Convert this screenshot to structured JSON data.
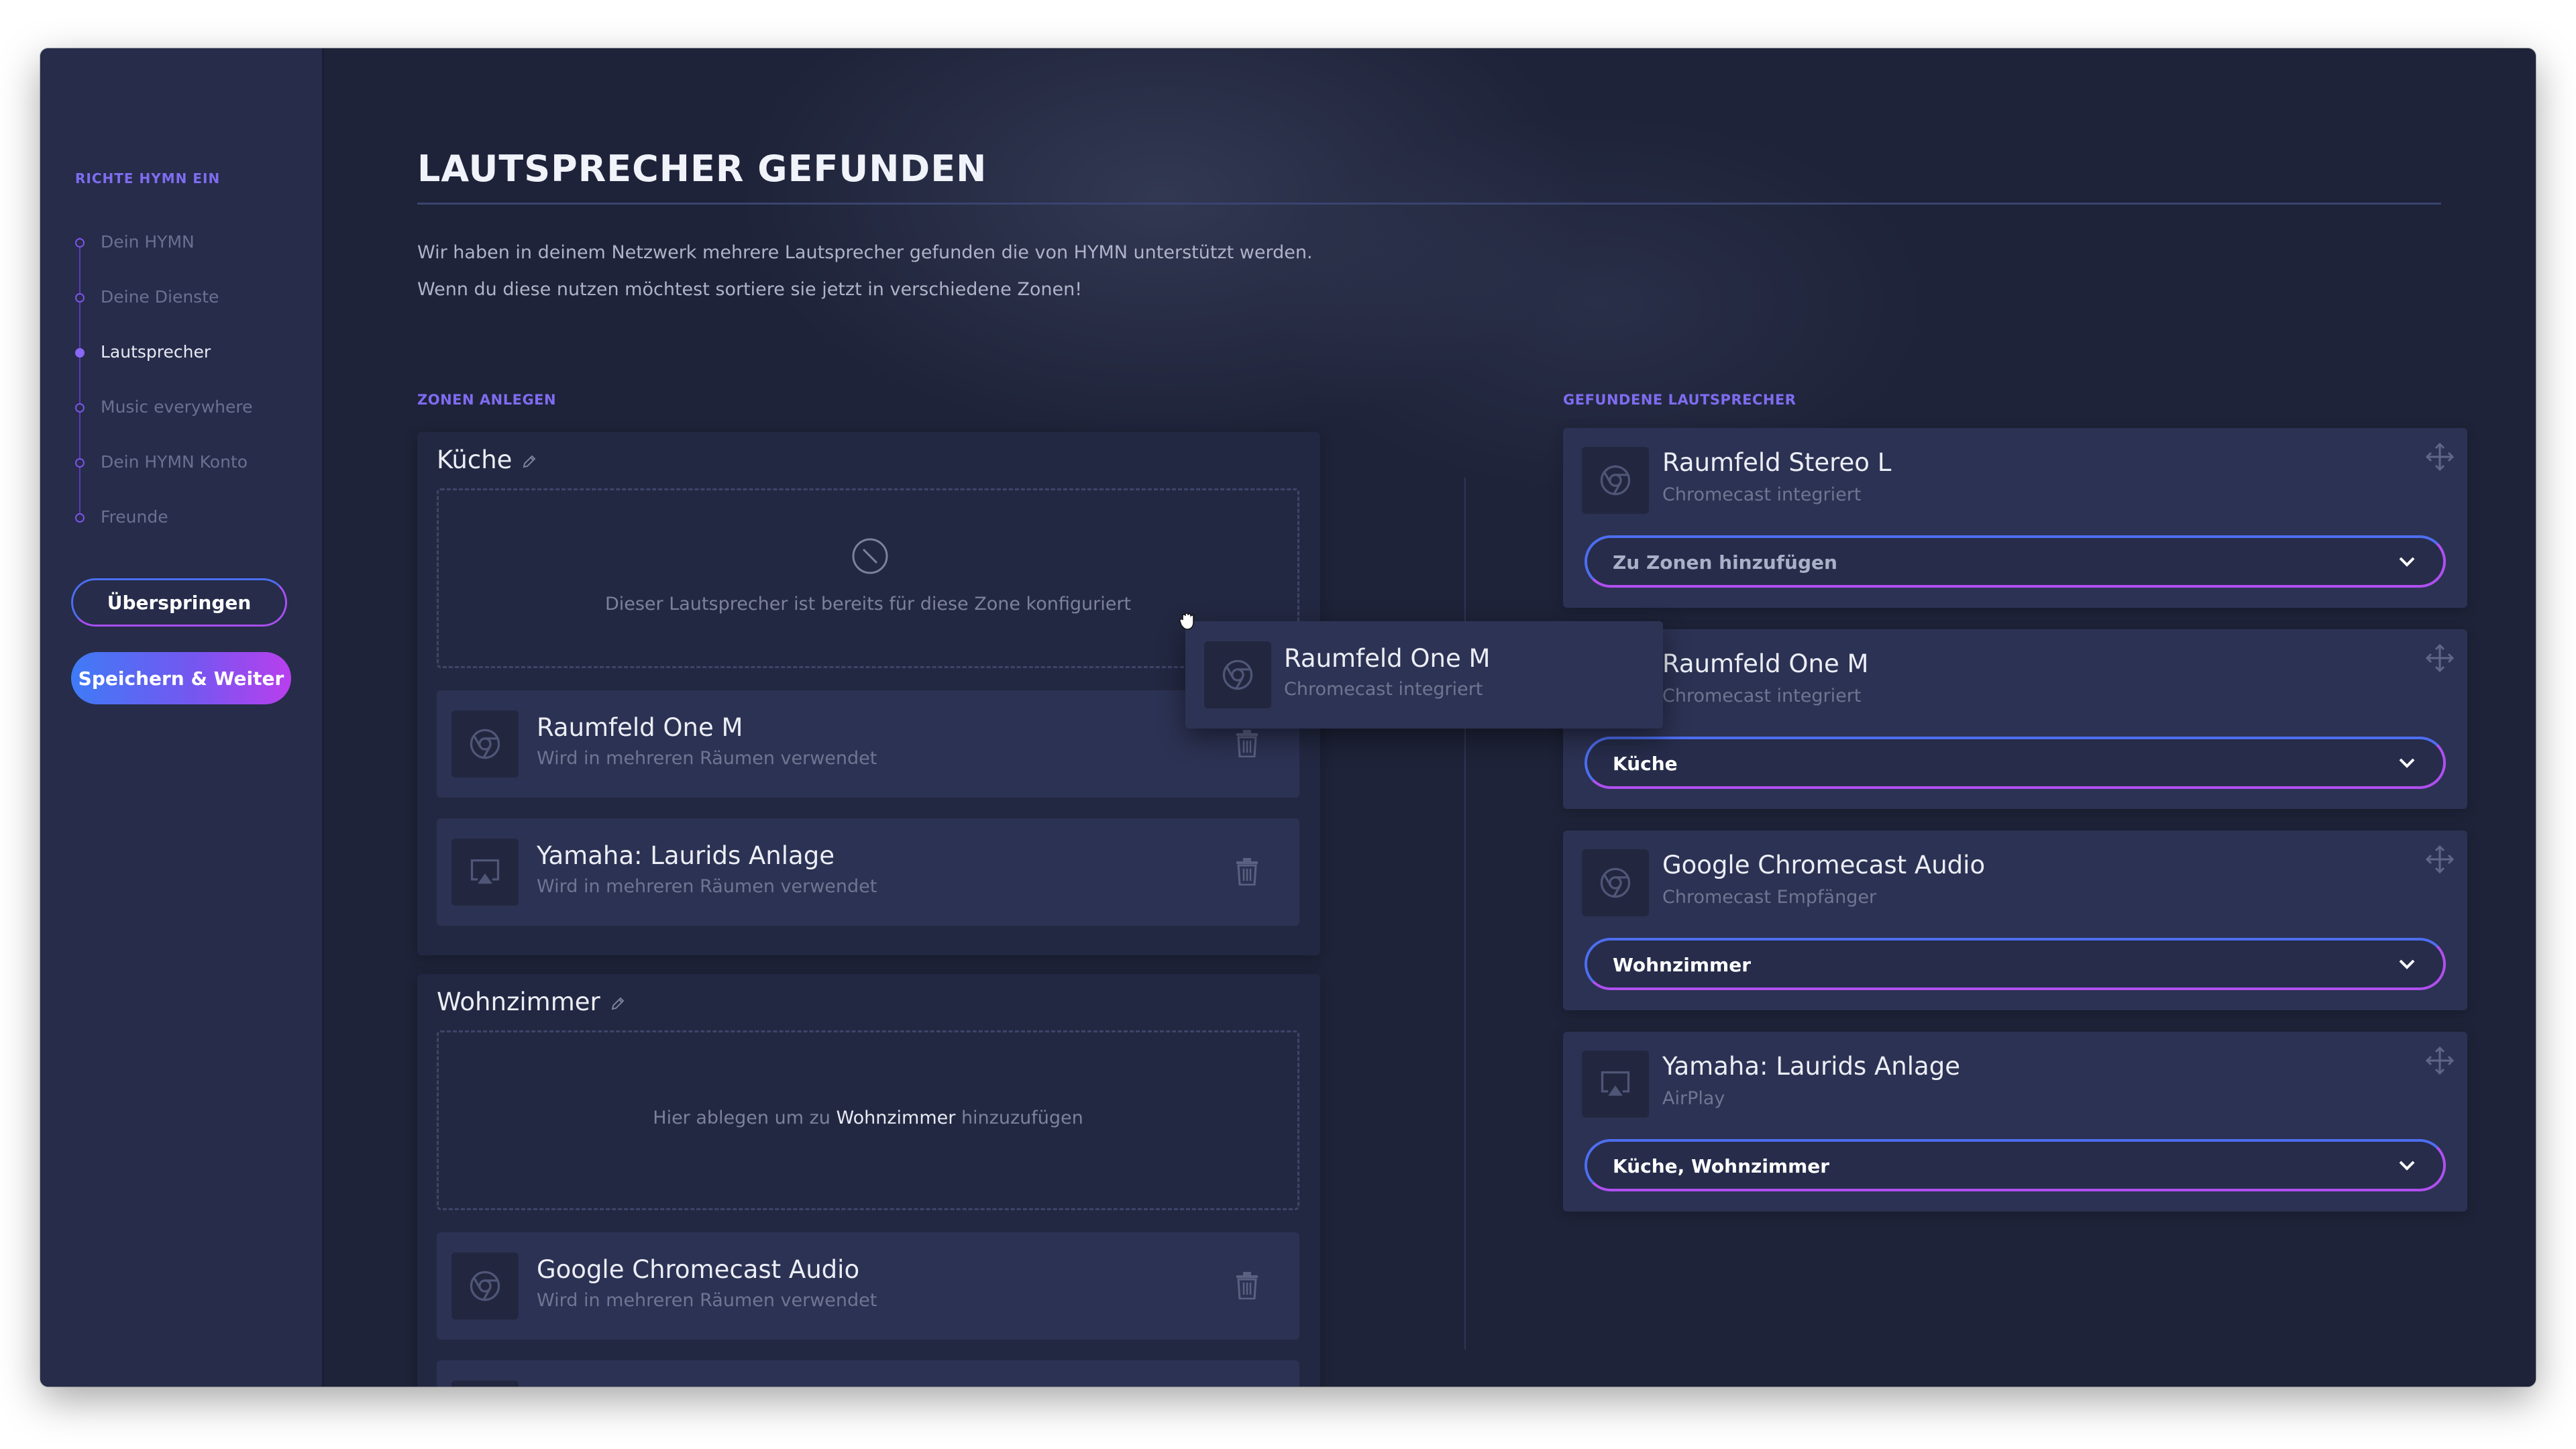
{
  "sidebar": {
    "title": "RICHTE HYMN EIN",
    "steps": [
      {
        "label": "Dein HYMN",
        "active": false
      },
      {
        "label": "Deine Dienste",
        "active": false
      },
      {
        "label": "Lautsprecher",
        "active": true
      },
      {
        "label": "Music everywhere",
        "active": false
      },
      {
        "label": "Dein HYMN Konto",
        "active": false
      },
      {
        "label": "Freunde",
        "active": false
      }
    ],
    "skip_label": "Überspringen",
    "save_label": "Speichern & Weiter"
  },
  "header": {
    "title": "LAUTSPRECHER GEFUNDEN",
    "intro_line1": "Wir haben in deinem Netzwerk mehrere Lautsprecher gefunden die von HYMN unterstützt werden.",
    "intro_line2": "Wenn du diese nutzen möchtest sortiere sie jetzt in verschiedene Zonen!"
  },
  "zones_section": {
    "label": "ZONEN ANLEGEN",
    "zones": [
      {
        "name": "Küche",
        "dropzone_text": "Dieser Lautsprecher ist bereits für diese Zone konfiguriert",
        "speakers": [
          {
            "name": "Raumfeld One M",
            "status": "Wird in mehreren Räumen verwendet",
            "icon": "chromecast-icon"
          },
          {
            "name": "Yamaha: Laurids Anlage",
            "status": "Wird in mehreren Räumen verwendet",
            "icon": "airplay-icon"
          }
        ]
      },
      {
        "name": "Wohnzimmer",
        "dropzone_prefix": "Hier ablegen um zu",
        "dropzone_zone": "Wohnzimmer",
        "dropzone_suffix": "hinzuzufügen",
        "speakers": [
          {
            "name": "Google Chromecast Audio",
            "status": "Wird in mehreren Räumen verwendet",
            "icon": "chromecast-icon"
          }
        ]
      }
    ]
  },
  "found_section": {
    "label": "GEFUNDENE LAUTSPRECHER",
    "speakers": [
      {
        "name": "Raumfeld Stereo L",
        "type": "Chromecast integriert",
        "zones": "Zu Zonen hinzufügen",
        "icon": "chromecast-icon"
      },
      {
        "name": "Raumfeld One M",
        "type": "Chromecast integriert",
        "zones": "Küche",
        "icon": "chromecast-icon"
      },
      {
        "name": "Google Chromecast Audio",
        "type": "Chromecast Empfänger",
        "zones": "Wohnzimmer",
        "icon": "chromecast-icon"
      },
      {
        "name": "Yamaha: Laurids Anlage",
        "type": "AirPlay",
        "zones": "Küche, Wohnzimmer",
        "icon": "airplay-icon"
      }
    ]
  },
  "dragging": {
    "name": "Raumfeld One M",
    "type": "Chromecast integriert",
    "icon": "chromecast-icon"
  },
  "colors": {
    "accent_purple": "#7f6cf0",
    "gradient_start": "#3f7bf6",
    "gradient_end": "#b93fee"
  }
}
